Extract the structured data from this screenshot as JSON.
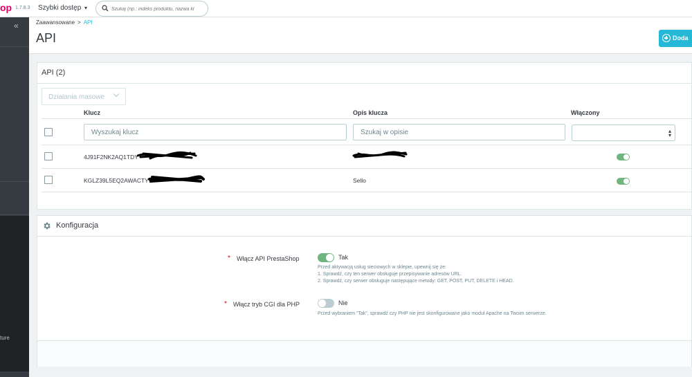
{
  "topbar": {
    "logo_text": "op",
    "version": "1.7.8.3",
    "quick_access": "Szybki dostęp",
    "search_placeholder": "Szukaj (np.: indeks produktu, nazwa kl"
  },
  "sidebar": {
    "collapse_label": "«",
    "partial_item_text": "ture"
  },
  "breadcrumb": {
    "parent": "Zaawansowane",
    "separator": ">",
    "current": "API"
  },
  "page": {
    "title": "API",
    "add_button_label": "Doda"
  },
  "api_panel": {
    "heading": "API (2)",
    "bulk_actions_label": "Działania masowe",
    "columns": [
      "Klucz",
      "Opis klucza",
      "Włączony"
    ],
    "filters": {
      "key_placeholder": "Wyszukaj klucz",
      "description_placeholder": "Szukaj w opisie",
      "enabled_value": ""
    },
    "rows": [
      {
        "key": "4J91F2NK2AQ1TDY",
        "description": "",
        "enabled": true
      },
      {
        "key": "KGLZ39L5EQ2AWACTY9",
        "description": "Sello",
        "enabled": true
      }
    ]
  },
  "config_panel": {
    "heading": "Konfiguracja",
    "required_marker": "*",
    "fields": [
      {
        "label": "Włącz API PrestaShop",
        "enabled": true,
        "value_text": "Tak",
        "help_lines": [
          "Przed aktywacją usług sieciowych w sklepie, upewnij się że:",
          "1. Sprawdź, czy ten serwer obsługuje przepisywanie adresów URL.",
          "2. Sprawdź, czy serwer obsługuje następujące metody: GET, POST, PUT, DELETE i HEAD."
        ]
      },
      {
        "label": "Włącz tryb CGI dla PHP",
        "enabled": false,
        "value_text": "Nie",
        "help_lines": [
          "Przed wybraniem \"Tak\", sprawdź czy PHP nie jest skonfigurowane jako moduł Apache na Twoim serwerze."
        ]
      }
    ]
  },
  "colors": {
    "accent": "#25b9d7",
    "brand": "#df0067",
    "switch_on": "#70b580",
    "switch_off": "#bbcdd2",
    "sidebar": "#363a41"
  },
  "icons": [
    "search-icon",
    "caret-down-icon",
    "collapse-icon",
    "add-circle-icon",
    "chevron-down-icon",
    "gear-icon",
    "sort-icon"
  ]
}
